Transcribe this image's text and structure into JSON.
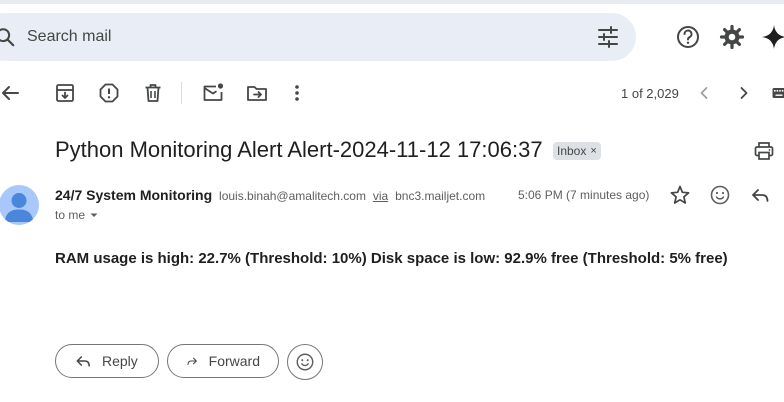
{
  "search": {
    "placeholder": "Search mail"
  },
  "pager": {
    "text": "1 of 2,029"
  },
  "email": {
    "subject": "Python Monitoring Alert Alert-2024-11-12 17:06:37",
    "label_chip": "Inbox",
    "label_chip_close": "×",
    "sender_name": "24/7 System Monitoring",
    "sender_email": "louis.binah@amalitech.com",
    "via_label": "via",
    "via_domain": "bnc3.mailjet.com",
    "recipient": "to me",
    "timestamp": "5:06 PM (7 minutes ago)",
    "body": "RAM usage is high: 22.7% (Threshold: 10%) Disk space is low: 92.9% free (Threshold: 5% free)"
  },
  "actions": {
    "reply_label": "Reply",
    "forward_label": "Forward"
  },
  "colors": {
    "search_bg": "#e9eef6",
    "avatar_bg": "#a8c7fa",
    "avatar_fg": "#4a86d9",
    "icon": "#444746"
  },
  "icons": [
    "search-icon",
    "tune-icon",
    "help-icon",
    "settings-icon",
    "gemini-icon",
    "back-arrow-icon",
    "archive-icon",
    "report-spam-icon",
    "delete-icon",
    "mark-unread-icon",
    "move-to-icon",
    "more-options-icon",
    "chevron-left-icon",
    "chevron-right-icon",
    "keyboard-icon",
    "print-icon",
    "star-icon",
    "emoji-icon",
    "reply-icon",
    "forward-icon"
  ]
}
